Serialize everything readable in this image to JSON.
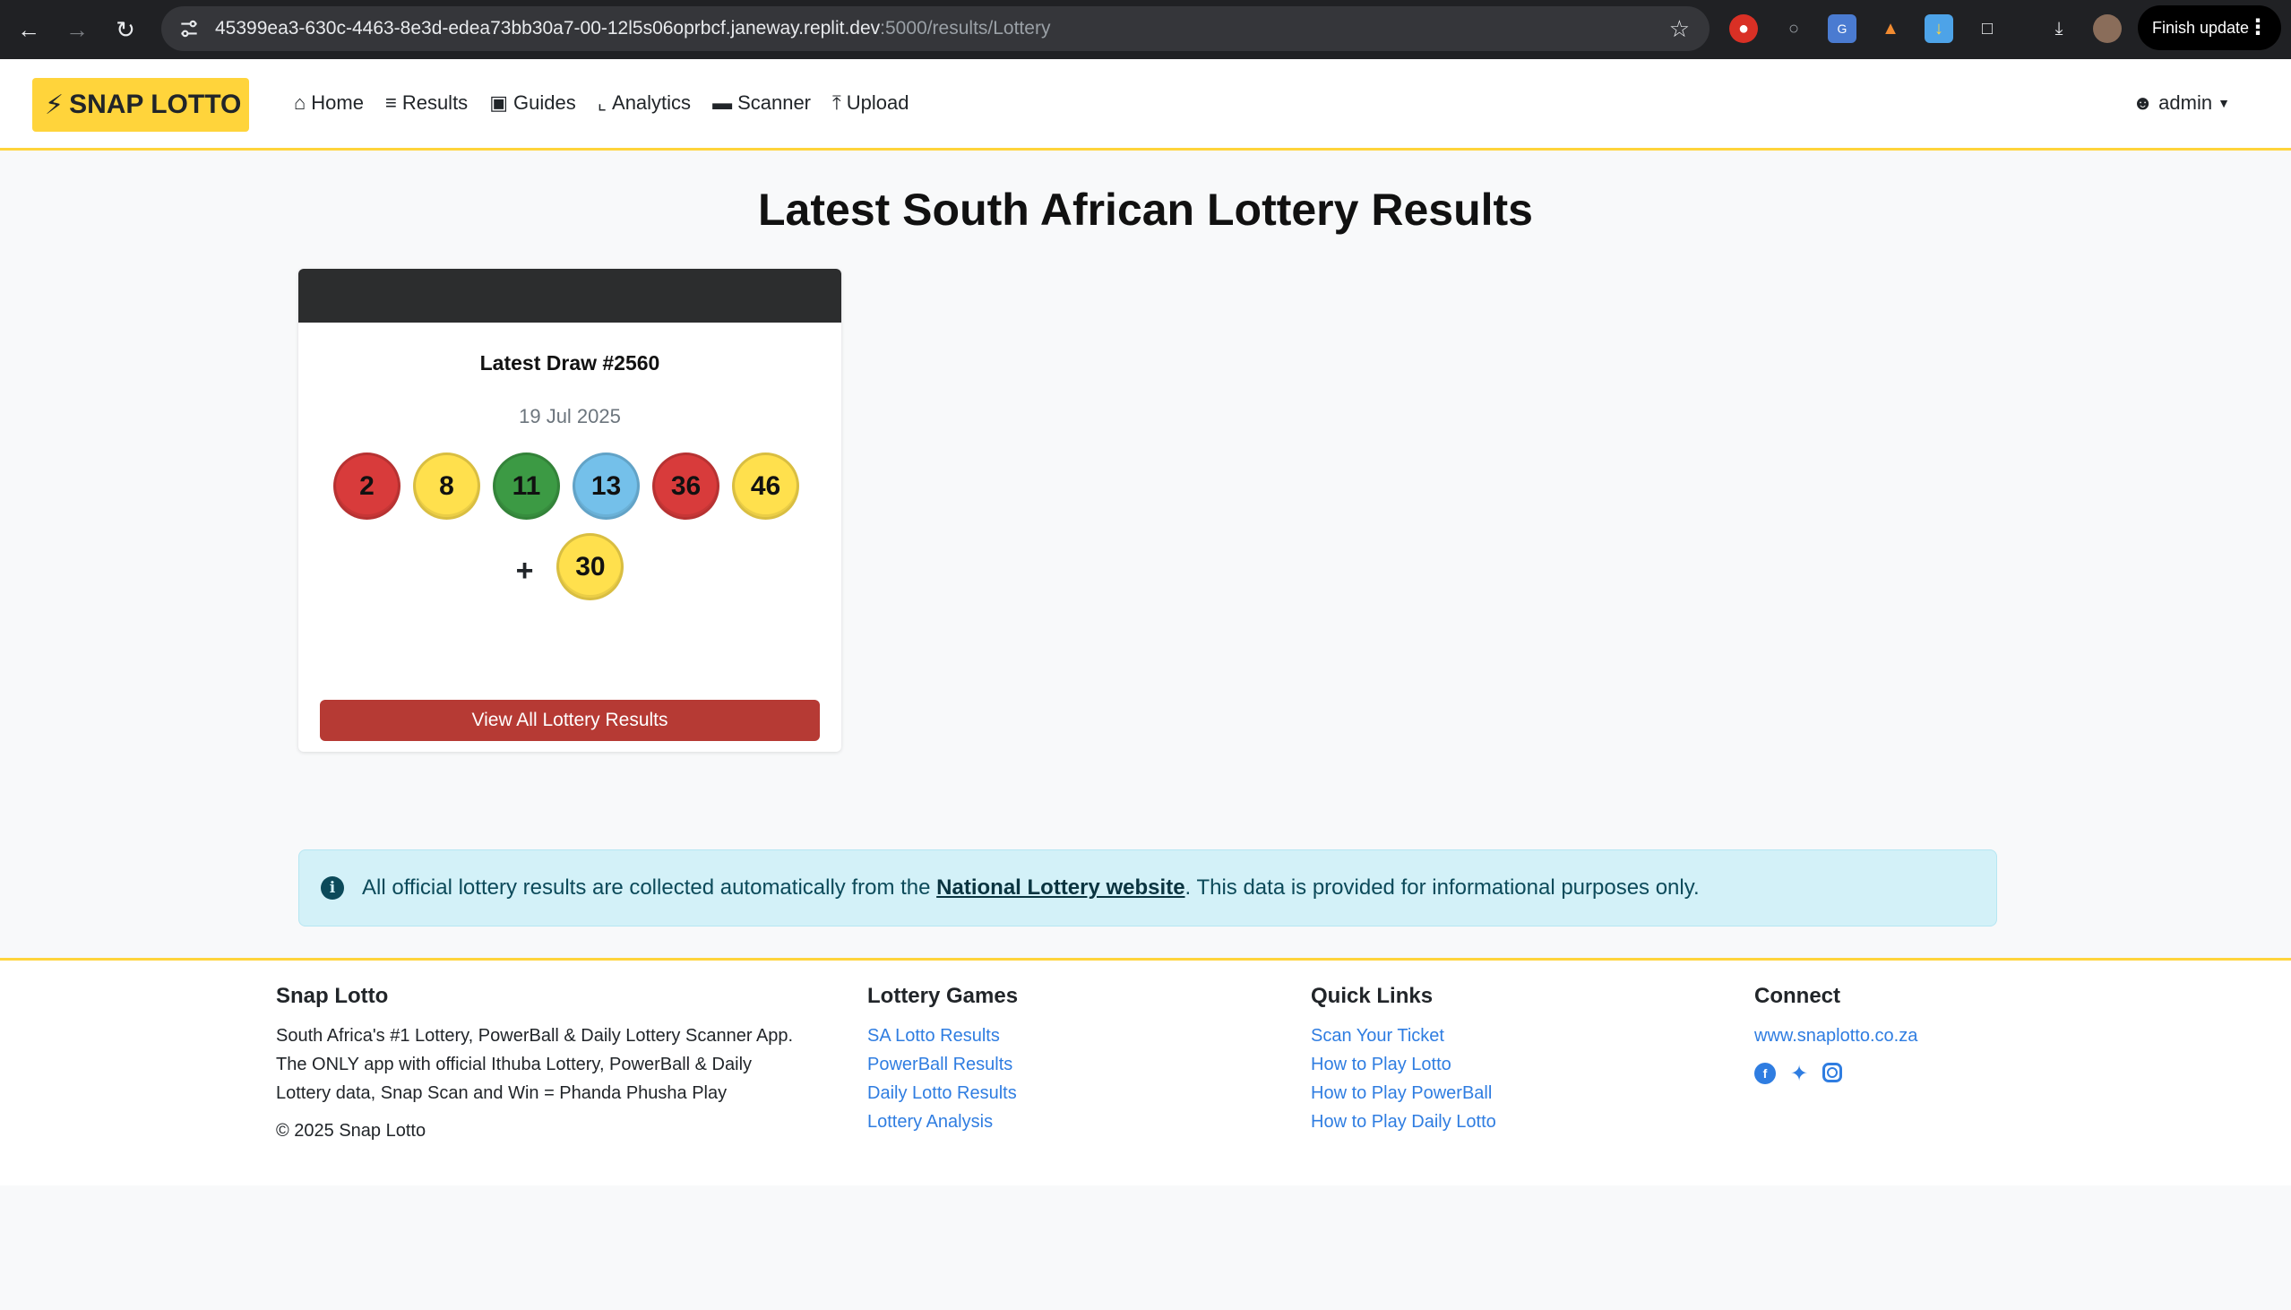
{
  "browser": {
    "url_host": "45399ea3-630c-4463-8e3d-edea73bb30a7-00-12l5s06oprbcf.janeway.replit.dev",
    "url_path": ":5000/results/Lottery",
    "finish_update": "Finish update"
  },
  "nav": {
    "brand": "SNAP LOTTO",
    "links": [
      "Home",
      "Results",
      "Guides",
      "Analytics",
      "Scanner",
      "Upload"
    ],
    "user": "admin"
  },
  "main": {
    "title": "Latest South African Lottery Results",
    "card": {
      "draw_title": "Latest Draw #2560",
      "date": "19 Jul 2025",
      "numbers": [
        "2",
        "8",
        "11",
        "13",
        "36",
        "46"
      ],
      "plus": "+",
      "bonus": "30",
      "button": "View All Lottery Results"
    },
    "alert": {
      "prefix": "All official lottery results are collected automatically from the ",
      "link": "National Lottery website",
      "suffix": ". This data is provided for informational purposes only."
    }
  },
  "footer": {
    "about": {
      "title": "Snap Lotto",
      "text1": "South Africa's #1 Lottery, PowerBall & Daily Lottery Scanner App.",
      "text2": "The ONLY app with official Ithuba Lottery, PowerBall & Daily",
      "text3": "Lottery data, Snap Scan and Win = Phanda Phusha Play",
      "copyright": "© 2025 Snap Lotto"
    },
    "games": {
      "title": "Lottery Games",
      "links": [
        "SA Lotto Results",
        "PowerBall Results",
        "Daily Lotto Results",
        "Lottery Analysis"
      ]
    },
    "quick": {
      "title": "Quick Links",
      "links": [
        "Scan Your Ticket",
        "How to Play Lotto",
        "How to Play PowerBall",
        "How to Play Daily Lotto"
      ]
    },
    "connect": {
      "title": "Connect",
      "site": "www.snaplotto.co.za"
    }
  },
  "colors": {
    "brand": "#ffd43b",
    "ball_red": "#d83b3b",
    "ball_yellow": "#ffe04d",
    "ball_green": "#3c9a44",
    "ball_blue": "#74c0ea",
    "button": "#b63a34",
    "link": "#2f7de1"
  }
}
